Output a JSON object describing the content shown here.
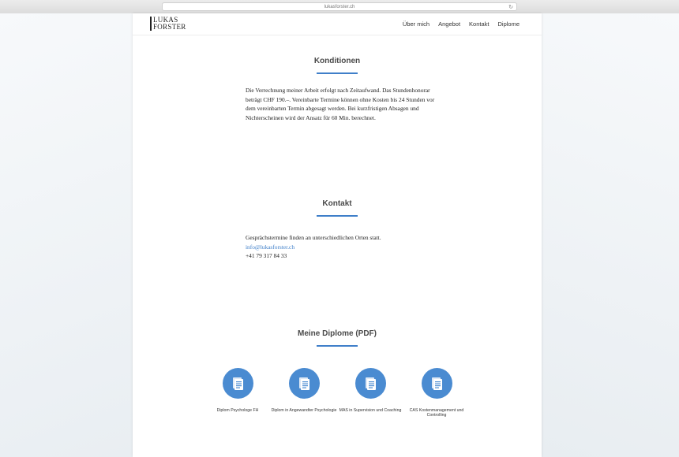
{
  "browser": {
    "url": "lukasforster.ch",
    "reload_icon": "reload-icon"
  },
  "header": {
    "logo_line1": "LUKAS",
    "logo_line2": "FORSTER",
    "nav": [
      "Über mich",
      "Angebot",
      "Kontakt",
      "Diplome"
    ]
  },
  "konditionen": {
    "title": "Konditionen",
    "text": "Die Verrechnung meiner Arbeit erfolgt nach Zeitaufwand. Das Stundenhonorar beträgt CHF 190.–. Vereinbarte Termine können ohne Kosten bis 24 Stunden vor dem vereinbarten Termin abgesagt werden. Bei kurzfristigen Absagen und Nichterscheinen wird der Ansatz für 60 Min. berechnet."
  },
  "kontakt": {
    "title": "Kontakt",
    "line1": "Gesprächstermine finden an unterschiedlichen Orten statt.",
    "email": "info@lukasforster.ch",
    "phone": "+41 79 317 84 33"
  },
  "diplome": {
    "title": "Meine Diplome (PDF)",
    "items": [
      {
        "label": "Diplom Psychologe FH",
        "icon": "document-icon"
      },
      {
        "label": "Diplom in Angewandter Psychologie",
        "icon": "document-icon"
      },
      {
        "label": "MAS in Supervision und Coaching",
        "icon": "document-icon"
      },
      {
        "label": "CAS Kostenmanagement und Controlling",
        "icon": "document-icon"
      }
    ]
  },
  "colors": {
    "accent": "#3f7fc9",
    "icon_circle": "#4a8bd1",
    "text": "#222222"
  }
}
